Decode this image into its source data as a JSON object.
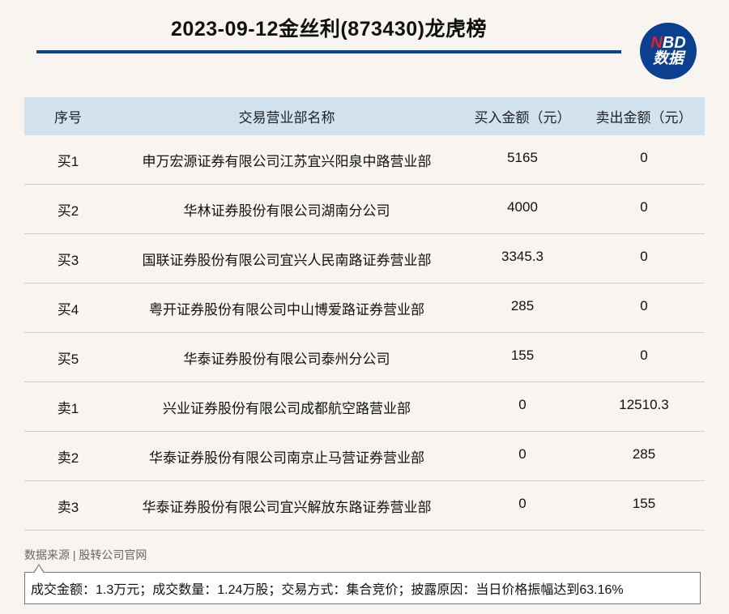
{
  "title": "2023-09-12金丝利(873430)龙虎榜",
  "logo": {
    "top_n": "N",
    "top_rest": "BD",
    "bottom": "数据"
  },
  "colors": {
    "brand": "#0b3f8f",
    "header_bg": "#d2e2ef",
    "accent_red": "#e2222a"
  },
  "table": {
    "headers": [
      "序号",
      "交易营业部名称",
      "买入金额（元）",
      "卖出金额（元）"
    ],
    "rows": [
      [
        "买1",
        "申万宏源证券有限公司江苏宜兴阳泉中路营业部",
        "5165",
        "0"
      ],
      [
        "买2",
        "华林证券股份有限公司湖南分公司",
        "4000",
        "0"
      ],
      [
        "买3",
        "国联证券股份有限公司宜兴人民南路证券营业部",
        "3345.3",
        "0"
      ],
      [
        "买4",
        "粤开证券股份有限公司中山博爱路证券营业部",
        "285",
        "0"
      ],
      [
        "买5",
        "华泰证券股份有限公司泰州分公司",
        "155",
        "0"
      ],
      [
        "卖1",
        "兴业证券股份有限公司成都航空路营业部",
        "0",
        "12510.3"
      ],
      [
        "卖2",
        "华泰证券股份有限公司南京止马营证券营业部",
        "0",
        "285"
      ],
      [
        "卖3",
        "华泰证券股份有限公司宜兴解放东路证券营业部",
        "0",
        "155"
      ]
    ]
  },
  "source": "数据来源 | 股转公司官网",
  "note": "成交金额：1.3万元；成交数量：1.24万股；交易方式：集合竞价；披露原因：当日价格振幅达到63.16%"
}
